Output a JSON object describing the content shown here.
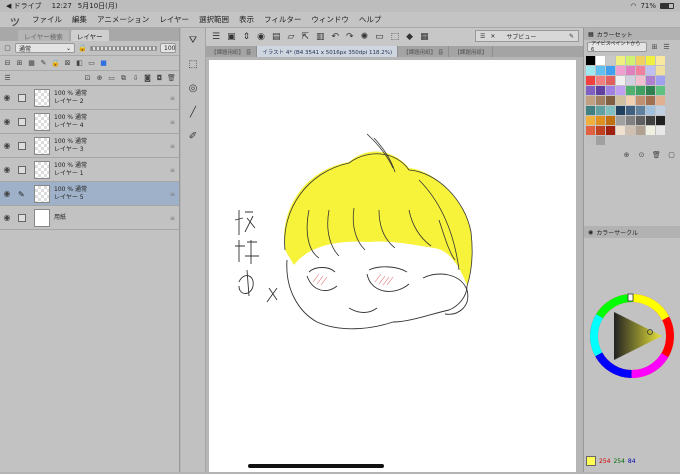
{
  "status": {
    "app": "◀ ドライブ",
    "time": "12:27",
    "date": "5月10日(月)",
    "battery": "71%"
  },
  "menu": [
    "ファイル",
    "編集",
    "アニメーション",
    "レイヤー",
    "選択範囲",
    "表示",
    "フィルター",
    "ウィンドウ",
    "ヘルプ"
  ],
  "left_tabs": [
    "レイヤー検索",
    "レイヤー"
  ],
  "blend_mode": "通常",
  "opacity_value": "100",
  "layers": [
    {
      "opacity": "100 %  通常",
      "name": "レイヤー 2",
      "selected": false,
      "paper": false
    },
    {
      "opacity": "100 %  通常",
      "name": "レイヤー 4",
      "selected": false,
      "paper": false
    },
    {
      "opacity": "100 %  通常",
      "name": "レイヤー 3",
      "selected": false,
      "paper": false
    },
    {
      "opacity": "100 %  通常",
      "name": "レイヤー 1",
      "selected": false,
      "paper": false
    },
    {
      "opacity": "100 %  通常",
      "name": "レイヤー 5",
      "selected": true,
      "paper": false
    },
    {
      "opacity": "",
      "name": "用紙",
      "selected": false,
      "paper": true
    }
  ],
  "doc_tabs": [
    "【課題用紙】 音",
    "イラスト 4* (B4 3541 x 5016px 350dpi 118.2%)",
    "【課題用紙】 音",
    "【課題用紙】"
  ],
  "subview_label": "サブビュー",
  "right_tabs": {
    "color_set": "カラーセット",
    "color_set_name": "アイビスペイントから6",
    "color_circle": "カラーサークル"
  },
  "color_values": [
    "254",
    "254",
    "84"
  ],
  "swatches": [
    "#000000",
    "#ffffff",
    "#c8c8c8",
    "#f0f080",
    "#d0f070",
    "#f0d060",
    "#f0f040",
    "#f8e8a0",
    "#a0e8f0",
    "#60c0f0",
    "#40a0f0",
    "#f0a0d0",
    "#e080c0",
    "#f080a0",
    "#c0c0f0",
    "#f0e0a0",
    "#f04040",
    "#f08080",
    "#e06060",
    "#f0f0f0",
    "#d0d0e0",
    "#f0c0d0",
    "#b080d0",
    "#a0a0f0",
    "#8060c0",
    "#6040a0",
    "#a080e0",
    "#c0a0f0",
    "#50b070",
    "#40a060",
    "#308050",
    "#60c080",
    "#c0a080",
    "#a08060",
    "#806040",
    "#d0c0a0",
    "#f0d0b0",
    "#c09070",
    "#a07050",
    "#e0b090",
    "#408080",
    "#60a0a0",
    "#80c0c0",
    "#204060",
    "#406080",
    "#6080a0",
    "#a0c0e0",
    "#c0d0e0",
    "#f0b040",
    "#e09020",
    "#c07010",
    "#a0a0a0",
    "#808080",
    "#606060",
    "#404040",
    "#202020",
    "#e06040",
    "#c04020",
    "#a02010",
    "#f0e0d0",
    "#d0c0b0",
    "#b0a090",
    "#f0f0e0",
    "#e8e8e8",
    "#c0c0c0",
    "#a0a0a0"
  ]
}
